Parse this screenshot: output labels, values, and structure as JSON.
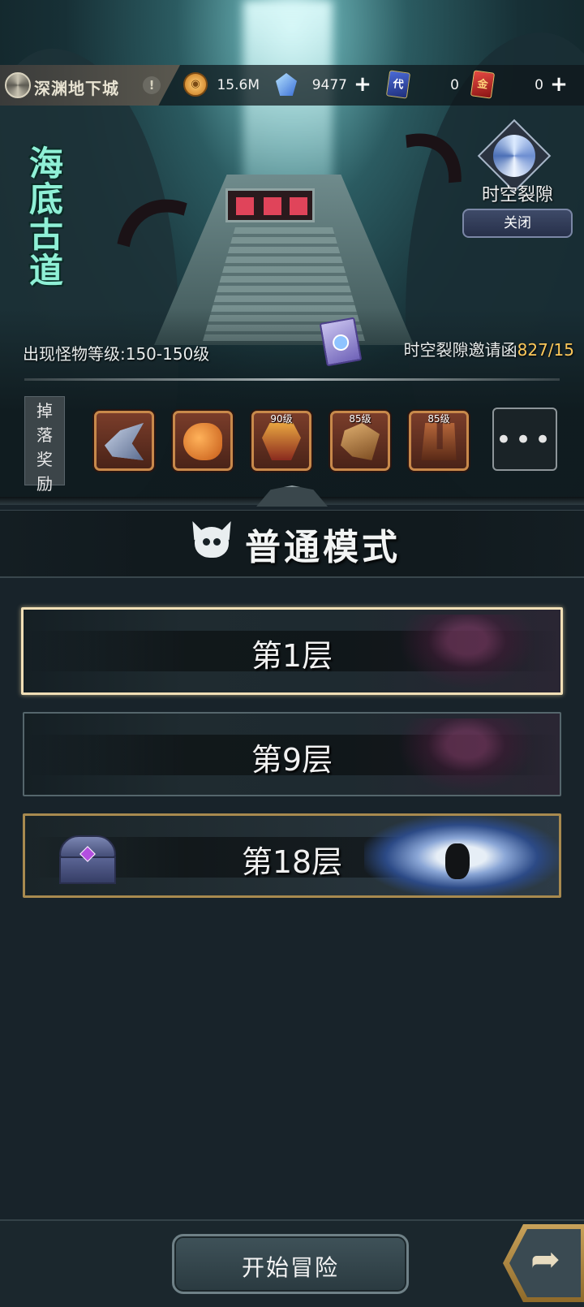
{
  "header": {
    "title": "深渊地下城",
    "info_icon": "exclamation-icon"
  },
  "currencies": [
    {
      "name": "gold",
      "icon": "gold-coin-icon",
      "value": "15.6M"
    },
    {
      "name": "crystal",
      "icon": "crystal-icon",
      "value": "9477",
      "has_add": true
    },
    {
      "name": "ticket-blue",
      "icon": "blue-ticket-icon",
      "value": "0"
    },
    {
      "name": "ticket-red",
      "icon": "red-ticket-icon",
      "value": "0",
      "has_add": true
    }
  ],
  "ticket_glyphs": {
    "blue": "代",
    "red": "金"
  },
  "plus_symbol": "+",
  "scene": {
    "logo_text": [
      "海",
      "底",
      "古",
      "道"
    ],
    "rift_label": "时空裂隙",
    "rift_close_label": "关闭",
    "monster_level": "出现怪物等级:150-150级",
    "invite_label": "时空裂隙邀请函",
    "invite_count": "827/15"
  },
  "drops": {
    "label": [
      "掉",
      "落",
      "奖",
      "励"
    ],
    "items": [
      {
        "icon": "shark-hero-icon",
        "level": ""
      },
      {
        "icon": "fish-hero-icon",
        "level": ""
      },
      {
        "icon": "armor-icon",
        "level": "90级"
      },
      {
        "icon": "gauntlet-icon",
        "level": "85级"
      },
      {
        "icon": "boots-icon",
        "level": "85级"
      }
    ],
    "more_label": "•••"
  },
  "mode": {
    "title": "普通模式",
    "icon": "skull-mask-icon"
  },
  "floors": [
    {
      "label": "第1层",
      "selected": true
    },
    {
      "label": "第9层",
      "selected": false
    },
    {
      "label": "第18层",
      "selected": false,
      "boss": true
    }
  ],
  "bottom": {
    "start_label": "开始冒险",
    "share_icon": "share-arrow-icon",
    "share_glyph": "➦"
  },
  "colors": {
    "accent_gold": "#ffc95a",
    "selected_border": "#f1dfb6",
    "background": "#18232a"
  }
}
